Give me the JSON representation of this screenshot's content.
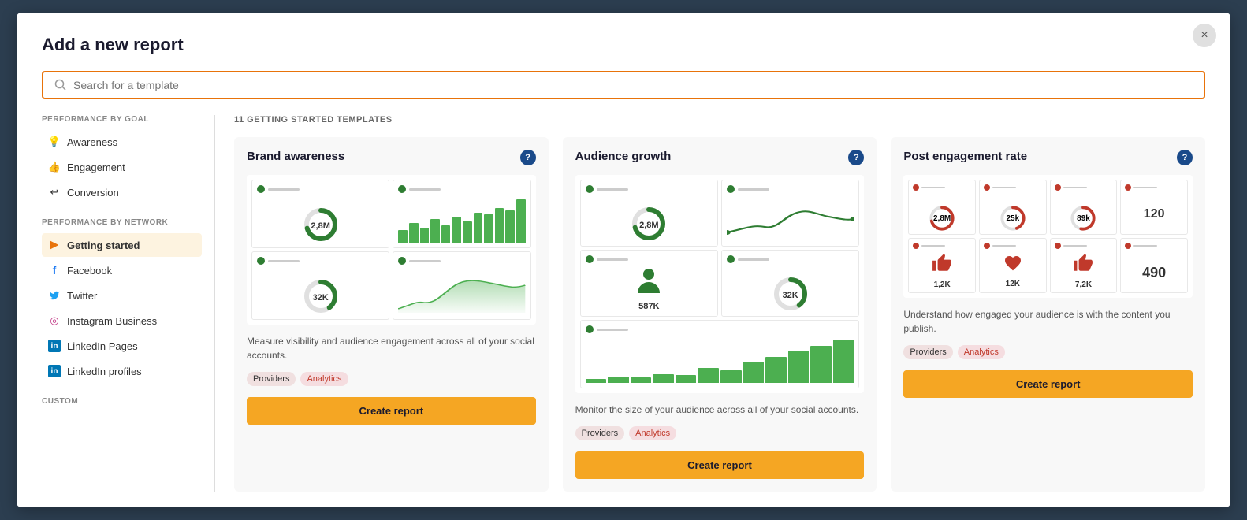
{
  "modal": {
    "title": "Add a new report",
    "close_label": "×"
  },
  "search": {
    "placeholder": "Search for a template"
  },
  "sidebar": {
    "performance_by_goal_label": "PERFORMANCE BY GOAL",
    "performance_by_network_label": "PERFORMANCE BY NETWORK",
    "custom_label": "CUSTOM",
    "goal_items": [
      {
        "id": "awareness",
        "label": "Awareness",
        "icon": "💡"
      },
      {
        "id": "engagement",
        "label": "Engagement",
        "icon": "👍"
      },
      {
        "id": "conversion",
        "label": "Conversion",
        "icon": "↩"
      }
    ],
    "network_items": [
      {
        "id": "getting-started",
        "label": "Getting started",
        "icon": "🚀",
        "active": true
      },
      {
        "id": "facebook",
        "label": "Facebook",
        "icon": "f"
      },
      {
        "id": "twitter",
        "label": "Twitter",
        "icon": "🐦"
      },
      {
        "id": "instagram",
        "label": "Instagram Business",
        "icon": "◎"
      },
      {
        "id": "linkedin-pages",
        "label": "LinkedIn Pages",
        "icon": "in"
      },
      {
        "id": "linkedin-profiles",
        "label": "LinkedIn profiles",
        "icon": "in"
      }
    ]
  },
  "templates": {
    "section_label": "11 GETTING STARTED TEMPLATES",
    "cards": [
      {
        "id": "brand-awareness",
        "title": "Brand awareness",
        "description": "Measure visibility and audience engagement across all of your social accounts.",
        "tags": [
          "Providers",
          "Analytics"
        ],
        "create_label": "Create report",
        "metrics": [
          "2,8M",
          "32K"
        ]
      },
      {
        "id": "audience-growth",
        "title": "Audience growth",
        "description": "Monitor the size of your audience across all of your social accounts.",
        "tags": [
          "Providers",
          "Analytics"
        ],
        "create_label": "Create report",
        "metrics": [
          "2,8M",
          "32K",
          "587K"
        ]
      },
      {
        "id": "post-engagement-rate",
        "title": "Post engagement rate",
        "description": "Understand how engaged your audience is with the content you publish.",
        "tags": [
          "Providers",
          "Analytics"
        ],
        "create_label": "Create report",
        "metrics": [
          "2,8M",
          "25k",
          "89k",
          "120",
          "1,2K",
          "12K",
          "7,2K",
          "490"
        ]
      }
    ]
  }
}
